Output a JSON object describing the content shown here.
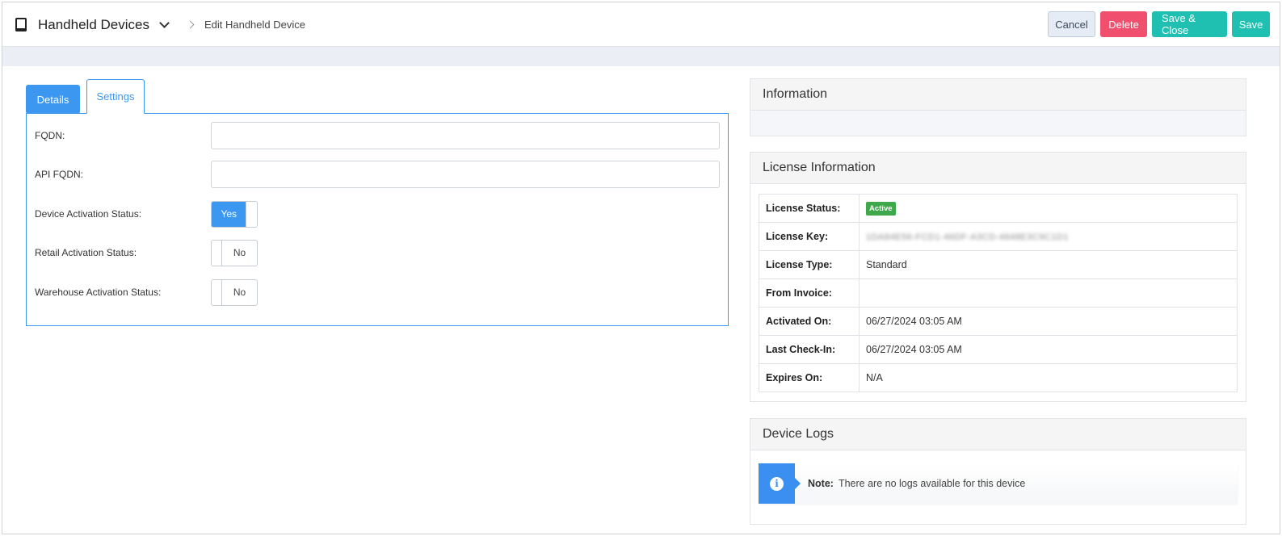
{
  "header": {
    "title": "Handheld Devices",
    "breadcrumb": "Edit Handheld Device",
    "buttons": {
      "cancel": "Cancel",
      "delete": "Delete",
      "save_close": "Save & Close",
      "save": "Save"
    }
  },
  "tabs": [
    {
      "label": "Details",
      "active": false
    },
    {
      "label": "Settings",
      "active": true
    }
  ],
  "form": {
    "fqdn": {
      "label": "FQDN:",
      "value": ""
    },
    "api_fqdn": {
      "label": "API FQDN:",
      "value": ""
    },
    "device_activation": {
      "label": "Device Activation Status:",
      "value": "Yes",
      "on": true
    },
    "retail_activation": {
      "label": "Retail Activation Status:",
      "value": "No",
      "on": false
    },
    "warehouse_activation": {
      "label": "Warehouse Activation Status:",
      "value": "No",
      "on": false
    }
  },
  "information": {
    "title": "Information"
  },
  "license": {
    "title": "License Information",
    "rows": [
      {
        "key": "License Status:",
        "value": "Active"
      },
      {
        "key": "License Key:",
        "value": "1DA84E56-FCD1-46DF-A3CD-4848E3C9C1D1"
      },
      {
        "key": "License Type:",
        "value": "Standard"
      },
      {
        "key": "From Invoice:",
        "value": ""
      },
      {
        "key": "Activated On:",
        "value": "06/27/2024 03:05 AM"
      },
      {
        "key": "Last Check-In:",
        "value": "06/27/2024 03:05 AM"
      },
      {
        "key": "Expires On:",
        "value": "N/A"
      }
    ]
  },
  "logs": {
    "title": "Device Logs",
    "note_label": "Note:",
    "note_text": "There are no logs available for this device"
  },
  "colors": {
    "primary": "#3b97f0",
    "danger": "#f0506e",
    "teal": "#1fc0b1",
    "success": "#3fa84a"
  }
}
